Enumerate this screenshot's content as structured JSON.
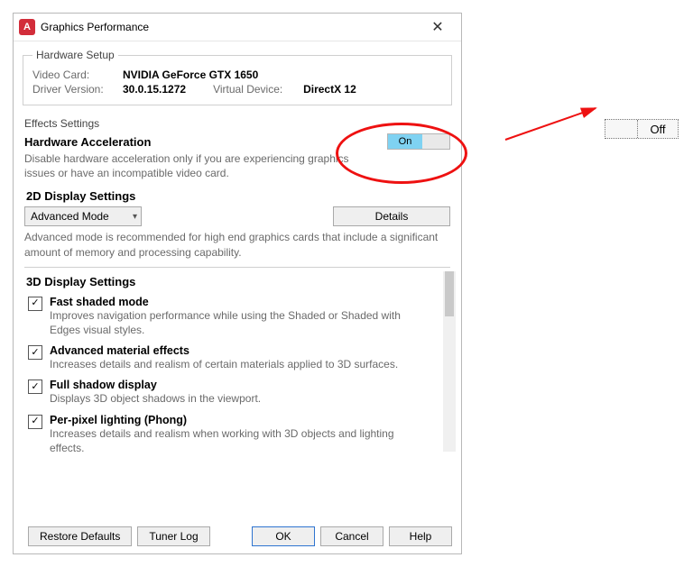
{
  "window": {
    "title": "Graphics Performance",
    "app_icon_letter": "A"
  },
  "hardware_setup": {
    "legend": "Hardware Setup",
    "video_card_label": "Video Card:",
    "video_card_value": "NVIDIA GeForce GTX 1650",
    "driver_label": "Driver Version:",
    "driver_value": "30.0.15.1272",
    "virtual_device_label": "Virtual Device:",
    "virtual_device_value": "DirectX 12"
  },
  "effects": {
    "legend": "Effects Settings",
    "hw_accel_title": "Hardware Acceleration",
    "hw_accel_desc": "Disable hardware acceleration only if you are experiencing graphics issues or have an incompatible video card.",
    "toggle_on_label": "On"
  },
  "display2d": {
    "title": "2D Display Settings",
    "mode_selected": "Advanced Mode",
    "details_label": "Details",
    "desc": "Advanced mode is recommended for high end graphics cards that include a significant amount of memory and processing capability."
  },
  "display3d": {
    "title": "3D Display Settings",
    "items": [
      {
        "checked": true,
        "title": "Fast shaded mode",
        "desc": "Improves navigation performance while using the Shaded or Shaded with Edges visual styles."
      },
      {
        "checked": true,
        "title": "Advanced material effects",
        "desc": "Increases details and realism of certain materials applied to 3D surfaces."
      },
      {
        "checked": true,
        "title": "Full shadow display",
        "desc": "Displays 3D object shadows in the viewport."
      },
      {
        "checked": true,
        "title": "Per-pixel lighting (Phong)",
        "desc": "Increases details and realism when working with 3D objects and lighting effects."
      }
    ]
  },
  "footer": {
    "restore": "Restore Defaults",
    "tuner": "Tuner Log",
    "ok": "OK",
    "cancel": "Cancel",
    "help": "Help"
  },
  "annotation": {
    "off_label": "Off"
  }
}
